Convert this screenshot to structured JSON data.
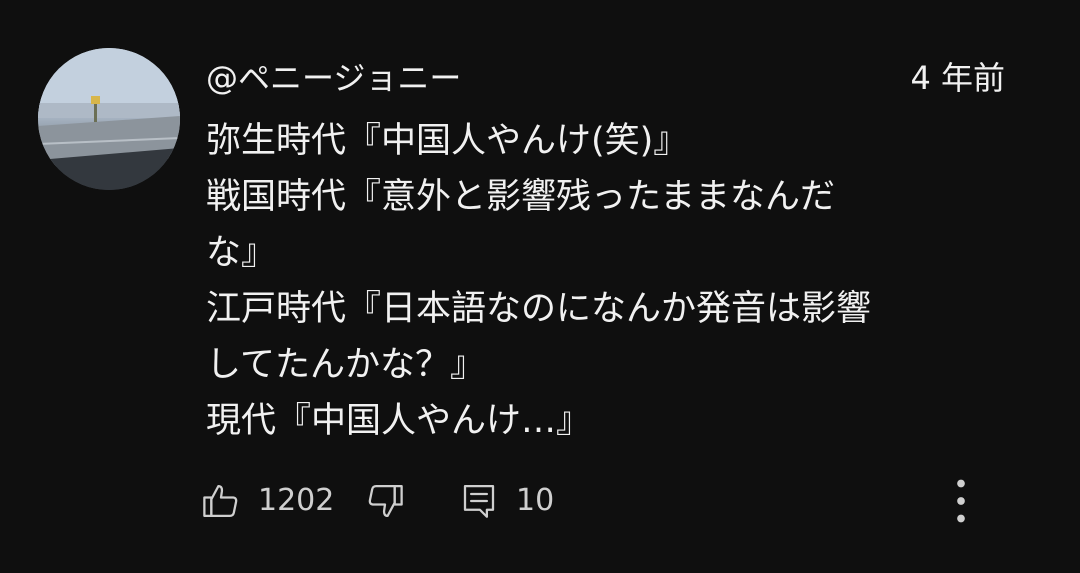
{
  "comment": {
    "author": "@ペニージョニー",
    "timestamp": "4 年前",
    "lines": [
      "弥生時代『中国人やんけ(笑)』",
      "戦国時代『意外と影響残ったままなんだ",
      "な』",
      "江戸時代『日本語なのになんか発音は影響",
      "してたんかな？』",
      "現代『中国人やんけ…』"
    ],
    "like_count": "1202",
    "reply_count": "10"
  },
  "icons": {
    "like": "thumbs-up-icon",
    "dislike": "thumbs-down-icon",
    "reply": "comment-icon",
    "menu": "more-vertical-icon"
  },
  "colors": {
    "background": "#0f0f0f",
    "text": "#f1f1f1",
    "icon": "#cfcfcf"
  }
}
